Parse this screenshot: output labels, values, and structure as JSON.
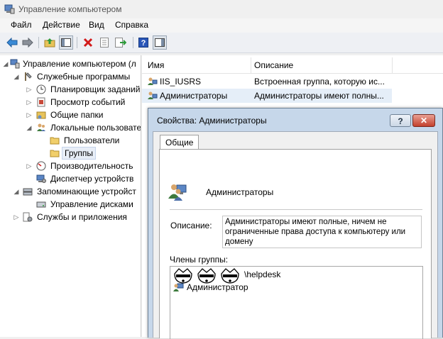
{
  "window": {
    "title": "Управление компьютером"
  },
  "menu": [
    "Файл",
    "Действие",
    "Вид",
    "Справка"
  ],
  "toolbar": {
    "icons": [
      "back-arrow-icon",
      "forward-arrow-icon",
      "up-folder-icon",
      "show-hide-tree-icon",
      "delete-icon",
      "properties-icon",
      "export-icon",
      "help-icon",
      "action-pane-icon"
    ]
  },
  "tree": {
    "items": [
      {
        "label": "Управление компьютером (л",
        "icon": "computer-management-icon"
      },
      {
        "label": "Служебные программы",
        "icon": "tools-icon"
      },
      {
        "label": "Планировщик заданий",
        "icon": "clock-icon"
      },
      {
        "label": "Просмотр событий",
        "icon": "event-viewer-icon"
      },
      {
        "label": "Общие папки",
        "icon": "shared-folders-icon"
      },
      {
        "label": "Локальные пользовате",
        "icon": "users-icon"
      },
      {
        "label": "Пользователи",
        "icon": "folder-icon"
      },
      {
        "label": "Группы",
        "icon": "folder-icon"
      },
      {
        "label": "Производительность",
        "icon": "performance-icon"
      },
      {
        "label": "Диспетчер устройств",
        "icon": "device-manager-icon"
      },
      {
        "label": "Запоминающие устройст",
        "icon": "storage-icon"
      },
      {
        "label": "Управление дисками",
        "icon": "disk-icon"
      },
      {
        "label": "Службы и приложения",
        "icon": "services-icon"
      }
    ]
  },
  "list": {
    "columns": [
      "Имя",
      "Описание"
    ],
    "rows": [
      {
        "name": "IIS_IUSRS",
        "description": "Встроенная группа, которую ис..."
      },
      {
        "name": "Администраторы",
        "description": "Администраторы имеют полны..."
      }
    ]
  },
  "dialog": {
    "title": "Свойства: Администраторы",
    "help_label": "?",
    "close_label": "✕",
    "tab": "Общие",
    "group_name": "Администраторы",
    "description_label": "Описание:",
    "description_value": "Администраторы имеют полные, ничем не ограниченные права доступа к компьютеру или домену",
    "members_label": "Члены группы:",
    "members": [
      {
        "name": "\\helpdesk",
        "redacted": true
      },
      {
        "name": "Администратор",
        "redacted": false
      }
    ]
  },
  "colors": {
    "selection": "#e5eef8",
    "dialog_frame": "#c6d7ea",
    "close_button": "#c3402c"
  }
}
